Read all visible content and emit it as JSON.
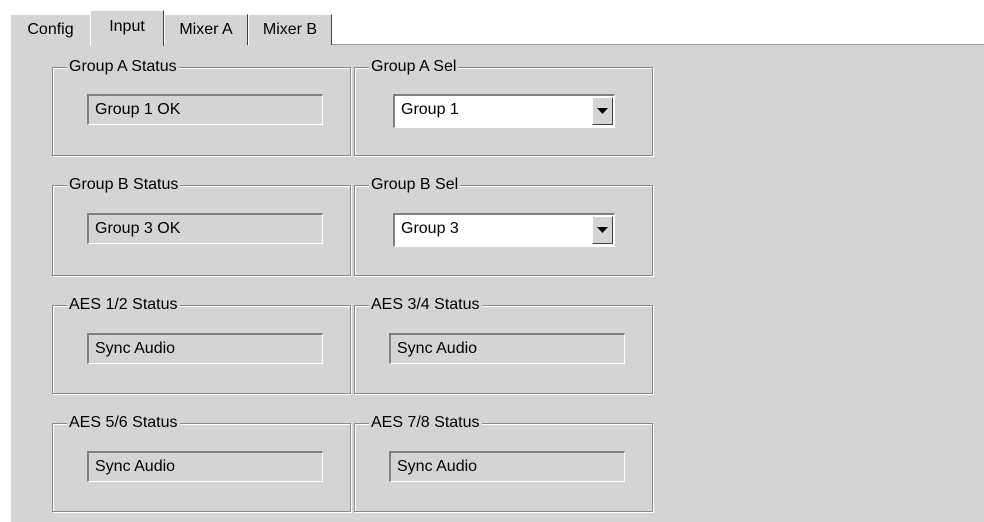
{
  "tabs": {
    "config": "Config",
    "input": "Input",
    "mixer_a": "Mixer A",
    "mixer_b": "Mixer B"
  },
  "groups": {
    "group_a_status": {
      "label": "Group A Status",
      "value": "Group 1 OK"
    },
    "group_a_sel": {
      "label": "Group A Sel",
      "value": "Group 1"
    },
    "group_b_status": {
      "label": "Group B Status",
      "value": "Group 3 OK"
    },
    "group_b_sel": {
      "label": "Group B Sel",
      "value": "Group 3"
    },
    "aes_12_status": {
      "label": "AES 1/2 Status",
      "value": "Sync Audio"
    },
    "aes_34_status": {
      "label": "AES 3/4 Status",
      "value": "Sync Audio"
    },
    "aes_56_status": {
      "label": "AES 5/6 Status",
      "value": "Sync Audio"
    },
    "aes_78_status": {
      "label": "AES 7/8 Status",
      "value": "Sync Audio"
    }
  },
  "icons": {
    "dropdown": "chevron-down-icon"
  },
  "colors": {
    "face": "#d4d4d4",
    "field": "#ffffff"
  }
}
